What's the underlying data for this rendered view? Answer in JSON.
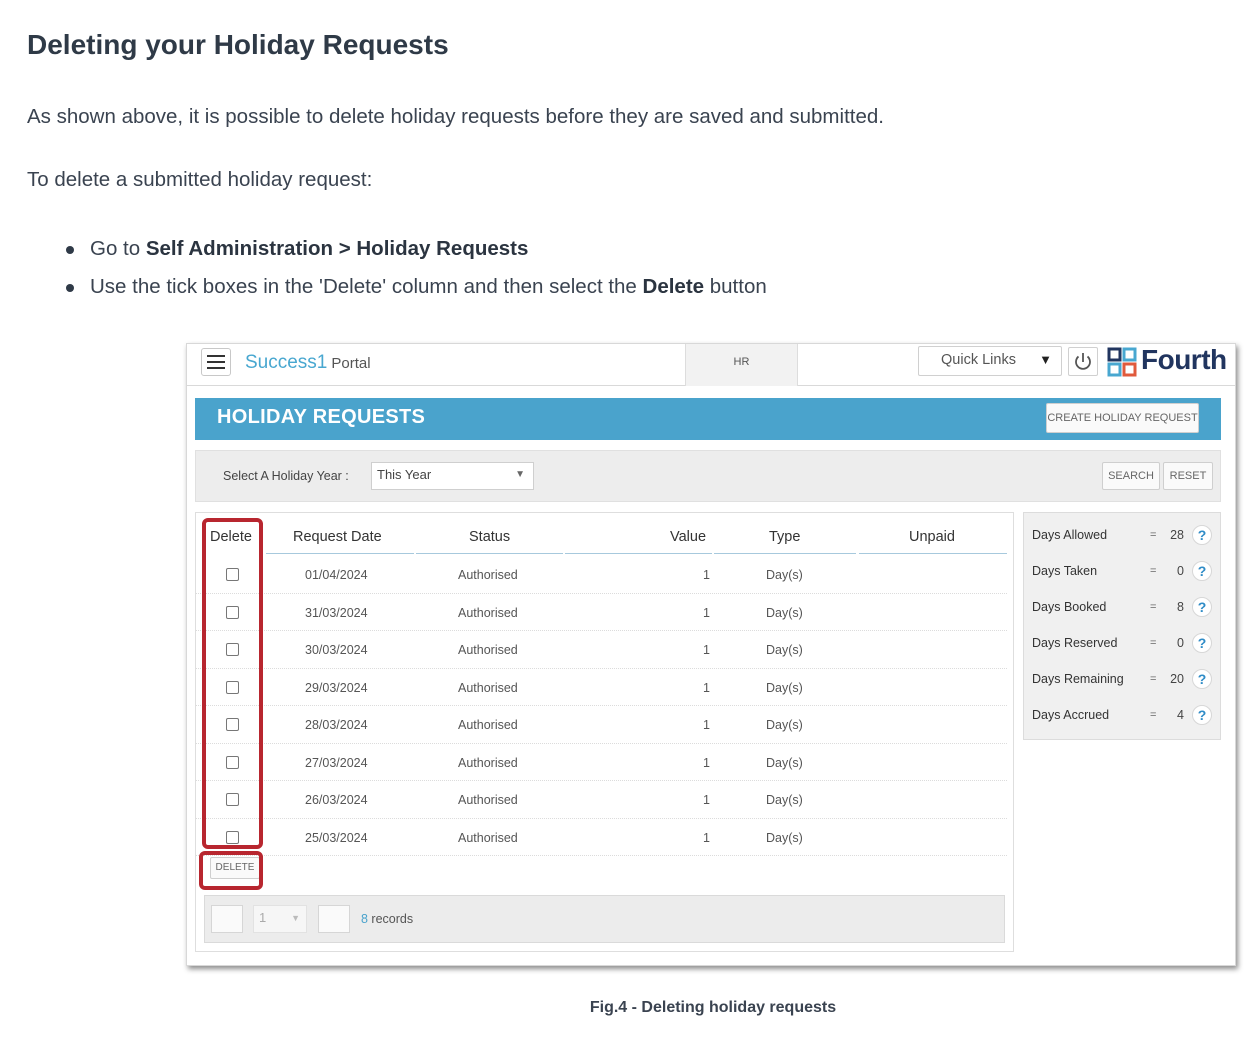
{
  "doc": {
    "title": "Deleting your Holiday Requests",
    "para1": "As shown above, it is possible to delete holiday requests before they are saved and submitted.",
    "para2": "To delete a submitted holiday request:",
    "bullet1_prefix": "Go to ",
    "bullet1_bold": "Self Administration > Holiday Requests",
    "bullet2_prefix": "Use the tick boxes in the 'Delete' column and then select the ",
    "bullet2_bold": "Delete",
    "bullet2_suffix": " button",
    "caption": "Fig.4 - Deleting holiday requests"
  },
  "app": {
    "brand": "Success1",
    "brand_suffix": "Portal",
    "hr_label": "HR",
    "quick_links": "Quick Links",
    "vendor_logo": "Fourth",
    "colors": {
      "accent": "#4aa3cc",
      "highlight": "#b8262f",
      "logo": "#21355f"
    }
  },
  "page": {
    "title": "HOLIDAY REQUESTS",
    "create_button": "CREATE HOLIDAY REQUEST",
    "filter_label": "Select A Holiday Year :",
    "year_value": "This Year",
    "search_button": "SEARCH",
    "reset_button": "RESET",
    "delete_button": "DELETE"
  },
  "table": {
    "headers": {
      "delete": "Delete",
      "request_date": "Request Date",
      "status": "Status",
      "value": "Value",
      "type": "Type",
      "unpaid": "Unpaid"
    },
    "rows": [
      {
        "date": "01/04/2024",
        "status": "Authorised",
        "value": "1",
        "type": "Day(s)",
        "checked": false
      },
      {
        "date": "31/03/2024",
        "status": "Authorised",
        "value": "1",
        "type": "Day(s)",
        "checked": false
      },
      {
        "date": "30/03/2024",
        "status": "Authorised",
        "value": "1",
        "type": "Day(s)",
        "checked": false
      },
      {
        "date": "29/03/2024",
        "status": "Authorised",
        "value": "1",
        "type": "Day(s)",
        "checked": false
      },
      {
        "date": "28/03/2024",
        "status": "Authorised",
        "value": "1",
        "type": "Day(s)",
        "checked": false
      },
      {
        "date": "27/03/2024",
        "status": "Authorised",
        "value": "1",
        "type": "Day(s)",
        "checked": false
      },
      {
        "date": "26/03/2024",
        "status": "Authorised",
        "value": "1",
        "type": "Day(s)",
        "checked": false
      },
      {
        "date": "25/03/2024",
        "status": "Authorised",
        "value": "1",
        "type": "Day(s)",
        "checked": false
      }
    ]
  },
  "pager": {
    "page": "1",
    "records_count": "8",
    "records_label": " records"
  },
  "stats": [
    {
      "label": "Days Allowed",
      "eq": "=",
      "value": "28",
      "help": "?"
    },
    {
      "label": "Days Taken",
      "eq": "=",
      "value": "0",
      "help": "?"
    },
    {
      "label": "Days Booked",
      "eq": "=",
      "value": "8",
      "help": "?"
    },
    {
      "label": "Days Reserved",
      "eq": "=",
      "value": "0",
      "help": "?"
    },
    {
      "label": "Days Remaining",
      "eq": "=",
      "value": "20",
      "help": "?"
    },
    {
      "label": "Days Accrued",
      "eq": "=",
      "value": "4",
      "help": "?"
    }
  ]
}
